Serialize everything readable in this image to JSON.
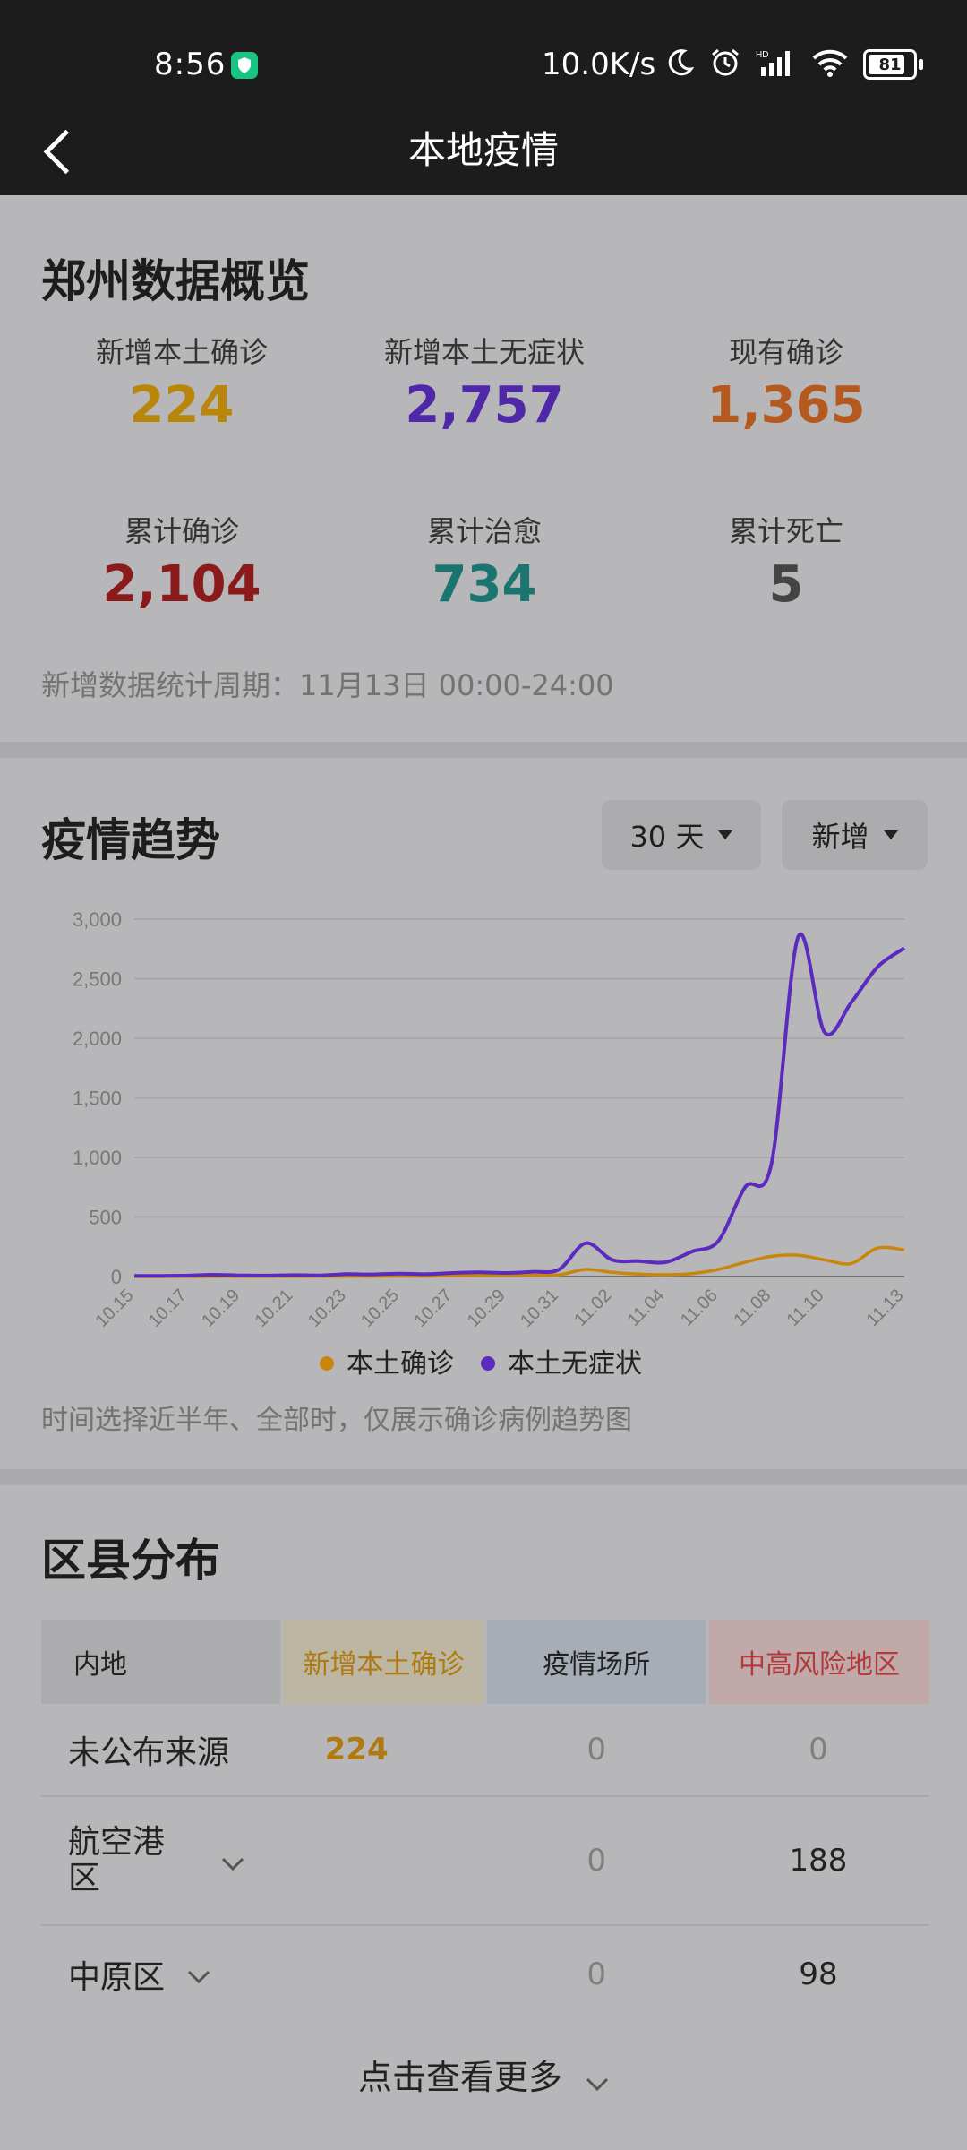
{
  "status_bar": {
    "time": "8:56",
    "net_speed": "10.0K/s",
    "battery": "81"
  },
  "nav": {
    "title": "本地疫情"
  },
  "overview": {
    "title": "郑州数据概览",
    "stats": [
      {
        "label": "新增本土确诊",
        "value": "224",
        "color": "#b8860b"
      },
      {
        "label": "新增本土无症状",
        "value": "2,757",
        "color": "#4f27a9"
      },
      {
        "label": "现有确诊",
        "value": "1,365",
        "color": "#b45a1e"
      },
      {
        "label": "累计确诊",
        "value": "2,104",
        "color": "#8b1a1a"
      },
      {
        "label": "累计治愈",
        "value": "734",
        "color": "#1a7570"
      },
      {
        "label": "累计死亡",
        "value": "5",
        "color": "#444444"
      }
    ],
    "period": "新增数据统计周期：11月13日 00:00-24:00"
  },
  "trend": {
    "title": "疫情趋势",
    "range_label": "30 天",
    "mode_label": "新增",
    "note": "时间选择近半年、全部时，仅展示确诊病例趋势图"
  },
  "chart_data": {
    "type": "line",
    "x": [
      "10.15",
      "10.16",
      "10.17",
      "10.18",
      "10.19",
      "10.20",
      "10.21",
      "10.22",
      "10.23",
      "10.24",
      "10.25",
      "10.26",
      "10.27",
      "10.28",
      "10.29",
      "10.30",
      "10.31",
      "11.01",
      "11.02",
      "11.03",
      "11.04",
      "11.05",
      "11.06",
      "11.07",
      "11.08",
      "11.09",
      "11.10",
      "11.11",
      "11.12",
      "11.13"
    ],
    "x_tick_labels": [
      "10.15",
      "10.17",
      "10.19",
      "10.21",
      "10.23",
      "10.25",
      "10.27",
      "10.29",
      "10.31",
      "11.02",
      "11.04",
      "11.06",
      "11.08",
      "11.10",
      "11.13"
    ],
    "series": [
      {
        "name": "本土确诊",
        "color": "#c8870b",
        "values": [
          0,
          0,
          0,
          2,
          1,
          1,
          2,
          2,
          3,
          3,
          4,
          4,
          5,
          8,
          8,
          10,
          15,
          60,
          35,
          20,
          15,
          25,
          60,
          120,
          170,
          180,
          140,
          110,
          240,
          224
        ]
      },
      {
        "name": "本土无症状",
        "color": "#5b2bbf",
        "values": [
          5,
          6,
          8,
          15,
          10,
          8,
          12,
          10,
          20,
          18,
          25,
          20,
          30,
          35,
          30,
          40,
          60,
          280,
          140,
          130,
          120,
          210,
          300,
          750,
          950,
          2850,
          2050,
          2300,
          2600,
          2757
        ]
      }
    ],
    "ylim": [
      0,
      3000
    ],
    "y_ticks": [
      "0",
      "500",
      "1,000",
      "1,500",
      "2,000",
      "2,500",
      "3,000"
    ],
    "grid": true,
    "legend": "bottom"
  },
  "district": {
    "title": "区县分布",
    "headers": [
      "内地",
      "新增本土确诊",
      "疫情场所",
      "中高风险地区"
    ],
    "rows": [
      {
        "name": "未公布来源",
        "confirmed": "224",
        "places": "0",
        "risk": "0"
      },
      {
        "name": "航空港区",
        "confirmed": "",
        "places": "0",
        "risk": "188"
      },
      {
        "name": "中原区",
        "confirmed": "",
        "places": "0",
        "risk": "98"
      }
    ],
    "more_label": "点击查看更多"
  }
}
